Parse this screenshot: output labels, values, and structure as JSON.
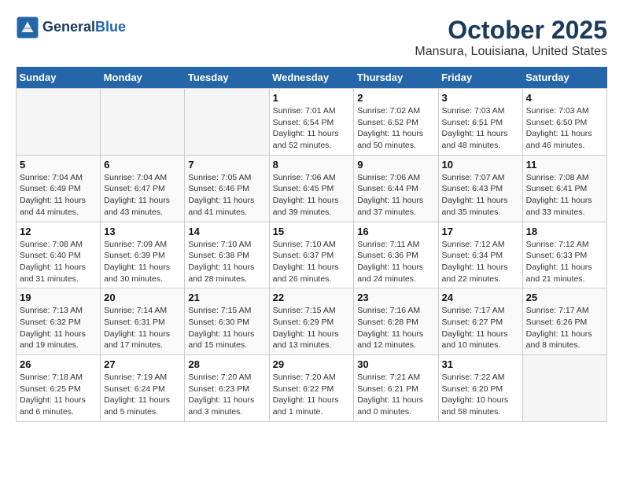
{
  "header": {
    "logo_line1": "General",
    "logo_line2": "Blue",
    "month_title": "October 2025",
    "location": "Mansura, Louisiana, United States"
  },
  "weekdays": [
    "Sunday",
    "Monday",
    "Tuesday",
    "Wednesday",
    "Thursday",
    "Friday",
    "Saturday"
  ],
  "weeks": [
    [
      {
        "day": "",
        "info": ""
      },
      {
        "day": "",
        "info": ""
      },
      {
        "day": "",
        "info": ""
      },
      {
        "day": "1",
        "info": "Sunrise: 7:01 AM\nSunset: 6:54 PM\nDaylight: 11 hours\nand 52 minutes."
      },
      {
        "day": "2",
        "info": "Sunrise: 7:02 AM\nSunset: 6:52 PM\nDaylight: 11 hours\nand 50 minutes."
      },
      {
        "day": "3",
        "info": "Sunrise: 7:03 AM\nSunset: 6:51 PM\nDaylight: 11 hours\nand 48 minutes."
      },
      {
        "day": "4",
        "info": "Sunrise: 7:03 AM\nSunset: 6:50 PM\nDaylight: 11 hours\nand 46 minutes."
      }
    ],
    [
      {
        "day": "5",
        "info": "Sunrise: 7:04 AM\nSunset: 6:49 PM\nDaylight: 11 hours\nand 44 minutes."
      },
      {
        "day": "6",
        "info": "Sunrise: 7:04 AM\nSunset: 6:47 PM\nDaylight: 11 hours\nand 43 minutes."
      },
      {
        "day": "7",
        "info": "Sunrise: 7:05 AM\nSunset: 6:46 PM\nDaylight: 11 hours\nand 41 minutes."
      },
      {
        "day": "8",
        "info": "Sunrise: 7:06 AM\nSunset: 6:45 PM\nDaylight: 11 hours\nand 39 minutes."
      },
      {
        "day": "9",
        "info": "Sunrise: 7:06 AM\nSunset: 6:44 PM\nDaylight: 11 hours\nand 37 minutes."
      },
      {
        "day": "10",
        "info": "Sunrise: 7:07 AM\nSunset: 6:43 PM\nDaylight: 11 hours\nand 35 minutes."
      },
      {
        "day": "11",
        "info": "Sunrise: 7:08 AM\nSunset: 6:41 PM\nDaylight: 11 hours\nand 33 minutes."
      }
    ],
    [
      {
        "day": "12",
        "info": "Sunrise: 7:08 AM\nSunset: 6:40 PM\nDaylight: 11 hours\nand 31 minutes."
      },
      {
        "day": "13",
        "info": "Sunrise: 7:09 AM\nSunset: 6:39 PM\nDaylight: 11 hours\nand 30 minutes."
      },
      {
        "day": "14",
        "info": "Sunrise: 7:10 AM\nSunset: 6:38 PM\nDaylight: 11 hours\nand 28 minutes."
      },
      {
        "day": "15",
        "info": "Sunrise: 7:10 AM\nSunset: 6:37 PM\nDaylight: 11 hours\nand 26 minutes."
      },
      {
        "day": "16",
        "info": "Sunrise: 7:11 AM\nSunset: 6:36 PM\nDaylight: 11 hours\nand 24 minutes."
      },
      {
        "day": "17",
        "info": "Sunrise: 7:12 AM\nSunset: 6:34 PM\nDaylight: 11 hours\nand 22 minutes."
      },
      {
        "day": "18",
        "info": "Sunrise: 7:12 AM\nSunset: 6:33 PM\nDaylight: 11 hours\nand 21 minutes."
      }
    ],
    [
      {
        "day": "19",
        "info": "Sunrise: 7:13 AM\nSunset: 6:32 PM\nDaylight: 11 hours\nand 19 minutes."
      },
      {
        "day": "20",
        "info": "Sunrise: 7:14 AM\nSunset: 6:31 PM\nDaylight: 11 hours\nand 17 minutes."
      },
      {
        "day": "21",
        "info": "Sunrise: 7:15 AM\nSunset: 6:30 PM\nDaylight: 11 hours\nand 15 minutes."
      },
      {
        "day": "22",
        "info": "Sunrise: 7:15 AM\nSunset: 6:29 PM\nDaylight: 11 hours\nand 13 minutes."
      },
      {
        "day": "23",
        "info": "Sunrise: 7:16 AM\nSunset: 6:28 PM\nDaylight: 11 hours\nand 12 minutes."
      },
      {
        "day": "24",
        "info": "Sunrise: 7:17 AM\nSunset: 6:27 PM\nDaylight: 11 hours\nand 10 minutes."
      },
      {
        "day": "25",
        "info": "Sunrise: 7:17 AM\nSunset: 6:26 PM\nDaylight: 11 hours\nand 8 minutes."
      }
    ],
    [
      {
        "day": "26",
        "info": "Sunrise: 7:18 AM\nSunset: 6:25 PM\nDaylight: 11 hours\nand 6 minutes."
      },
      {
        "day": "27",
        "info": "Sunrise: 7:19 AM\nSunset: 6:24 PM\nDaylight: 11 hours\nand 5 minutes."
      },
      {
        "day": "28",
        "info": "Sunrise: 7:20 AM\nSunset: 6:23 PM\nDaylight: 11 hours\nand 3 minutes."
      },
      {
        "day": "29",
        "info": "Sunrise: 7:20 AM\nSunset: 6:22 PM\nDaylight: 11 hours\nand 1 minute."
      },
      {
        "day": "30",
        "info": "Sunrise: 7:21 AM\nSunset: 6:21 PM\nDaylight: 11 hours\nand 0 minutes."
      },
      {
        "day": "31",
        "info": "Sunrise: 7:22 AM\nSunset: 6:20 PM\nDaylight: 10 hours\nand 58 minutes."
      },
      {
        "day": "",
        "info": ""
      }
    ]
  ]
}
